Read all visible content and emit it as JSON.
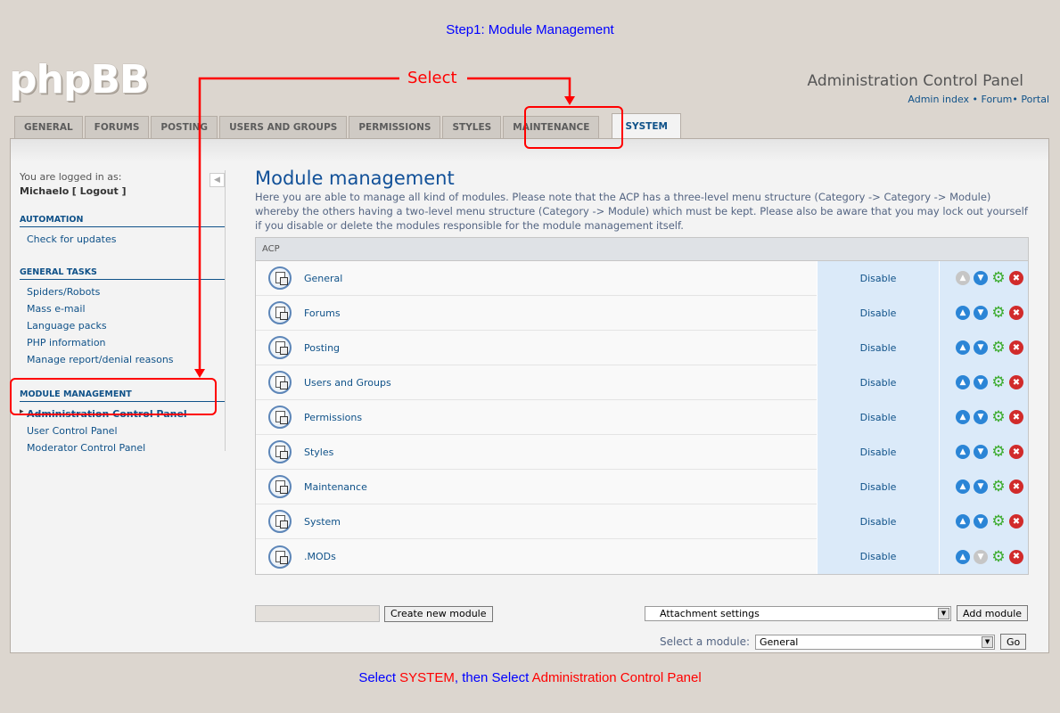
{
  "step_title": "Step1: Module Management",
  "logo": "phpBB",
  "header": {
    "title": "Administration Control Panel",
    "links": [
      "Admin index",
      "Forum",
      "Portal"
    ]
  },
  "tabs": [
    {
      "label": "GENERAL"
    },
    {
      "label": "FORUMS"
    },
    {
      "label": "POSTING"
    },
    {
      "label": "USERS AND GROUPS"
    },
    {
      "label": "PERMISSIONS"
    },
    {
      "label": "STYLES"
    },
    {
      "label": "MAINTENANCE"
    },
    {
      "label": "SYSTEM"
    }
  ],
  "sidebar": {
    "logged_in_label": "You are logged in as:",
    "username": "Michaelo",
    "logout": "[ Logout ]",
    "sections": [
      {
        "title": "AUTOMATION",
        "items": [
          "Check for updates"
        ]
      },
      {
        "title": "GENERAL TASKS",
        "items": [
          "Spiders/Robots",
          "Mass e-mail",
          "Language packs",
          "PHP information",
          "Manage report/denial reasons"
        ]
      },
      {
        "title": "MODULE MANAGEMENT",
        "items": [
          "Administration Control Panel",
          "User Control Panel",
          "Moderator Control Panel"
        ]
      }
    ]
  },
  "main": {
    "title": "Module management",
    "description": "Here you are able to manage all kind of modules. Please note that the ACP has a three-level menu structure (Category -> Category -> Module) whereby the others having a two-level menu structure (Category -> Module) which must be kept. Please also be aware that you may lock out yourself if you disable or delete the modules responsible for the module management itself.",
    "table_head": "ACP",
    "modules": [
      {
        "name": "General",
        "status": "Disable"
      },
      {
        "name": "Forums",
        "status": "Disable"
      },
      {
        "name": "Posting",
        "status": "Disable"
      },
      {
        "name": "Users and Groups",
        "status": "Disable"
      },
      {
        "name": "Permissions",
        "status": "Disable"
      },
      {
        "name": "Styles",
        "status": "Disable"
      },
      {
        "name": "Maintenance",
        "status": "Disable"
      },
      {
        "name": "System",
        "status": "Disable"
      },
      {
        "name": ".MODs",
        "status": "Disable"
      }
    ],
    "create_button": "Create new module",
    "attach_select": "Attachment settings",
    "add_button": "Add module",
    "select_module_label": "Select a module:",
    "select_module_value": "General",
    "go_button": "Go"
  },
  "annotations": {
    "select_label": "Select",
    "caption": {
      "part1": "Select ",
      "part2": "SYSTEM",
      "part3": ", then Select ",
      "part4": "Administration Control Panel"
    }
  },
  "colors": {
    "background": "#dcd6cf",
    "link": "#105289",
    "annotation_red": "#ff0000",
    "annotation_blue": "#0000ff"
  }
}
